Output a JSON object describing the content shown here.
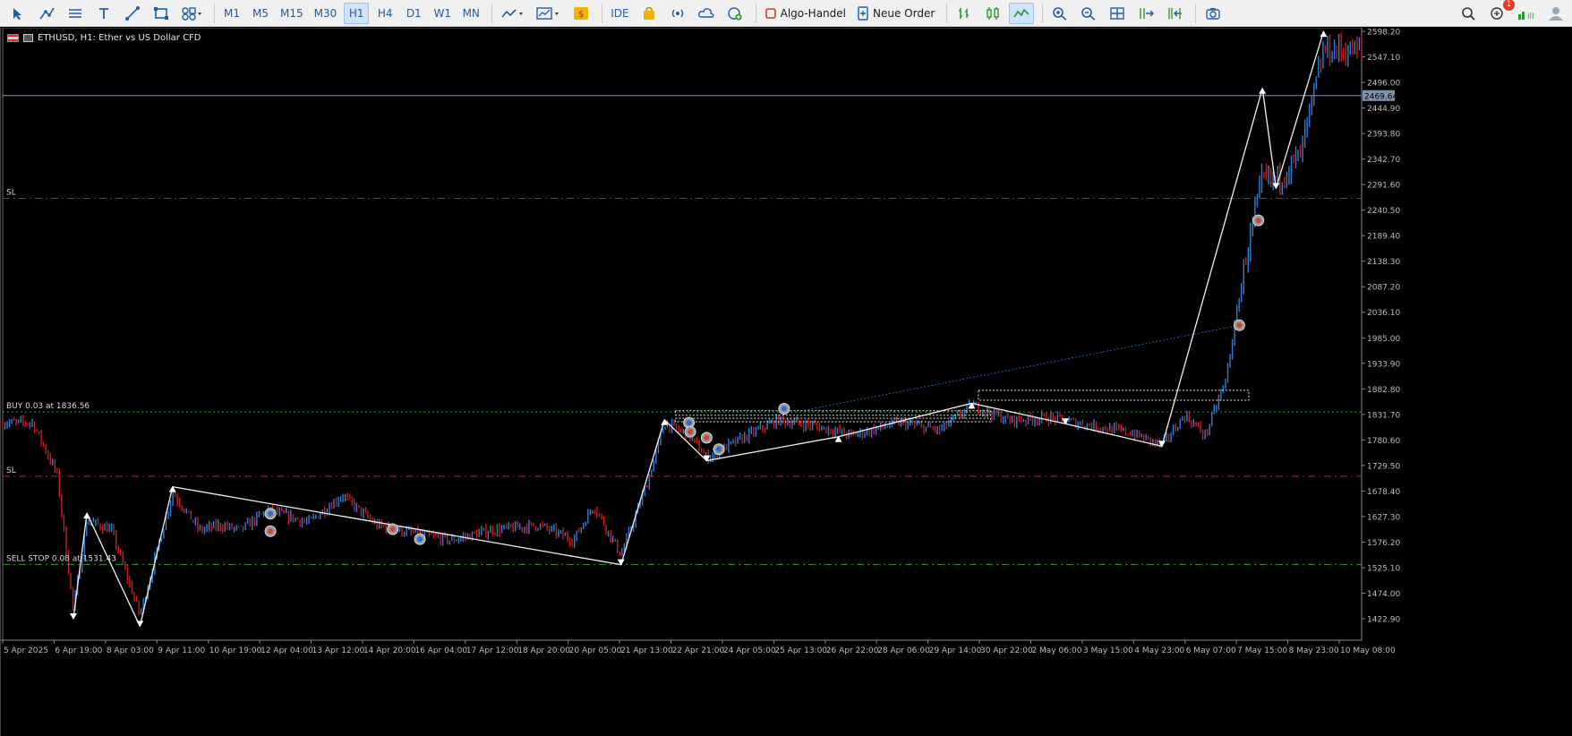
{
  "toolbar": {
    "timeframes": [
      "M1",
      "M5",
      "M15",
      "M30",
      "H1",
      "H4",
      "D1",
      "W1",
      "MN"
    ],
    "active_timeframe": "H1",
    "ide_label": "IDE",
    "algo_label": "Algo-Handel",
    "order_label": "Neue Order",
    "notification_count": "1"
  },
  "chart": {
    "symbol_line": "ETHUSD, H1:  Ether vs US Dollar CFD",
    "current_price": "2469.64",
    "colors": {
      "up": "#2f7fd8",
      "down": "#c81e1e",
      "background": "#000000",
      "axis_text": "#bdbdbd",
      "sl_line": "#c81e1e",
      "buy_line": "#2e9b2e"
    },
    "price_ticks": [
      "2598.20",
      "2547.10",
      "2496.00",
      "2444.90",
      "2393.80",
      "2342.70",
      "2291.60",
      "2240.50",
      "2189.40",
      "2138.30",
      "2087.20",
      "2036.10",
      "1985.00",
      "1933.90",
      "1882.80",
      "1831.70",
      "1780.60",
      "1729.50",
      "1678.40",
      "1627.30",
      "1576.20",
      "1525.10",
      "1474.00",
      "1422.90"
    ],
    "time_ticks": [
      "5 Apr 2025",
      "6 Apr 19:00",
      "8 Apr 03:00",
      "9 Apr 11:00",
      "10 Apr 19:00",
      "12 Apr 04:00",
      "13 Apr 12:00",
      "14 Apr 20:00",
      "16 Apr 04:00",
      "17 Apr 12:00",
      "18 Apr 20:00",
      "20 Apr 05:00",
      "21 Apr 13:00",
      "22 Apr 21:00",
      "24 Apr 05:00",
      "25 Apr 13:00",
      "26 Apr 22:00",
      "28 Apr 06:00",
      "29 Apr 14:00",
      "30 Apr 22:00",
      "2 May 06:00",
      "3 May 15:00",
      "4 May 23:00",
      "6 May 07:00",
      "7 May 15:00",
      "8 May 23:00",
      "10 May 08:00"
    ],
    "level_labels": {
      "sl_upper": "SL",
      "sl_lower": "SL",
      "buy": "BUY 0.03 at 1836.56",
      "sell_stop": "SELL STOP 0.08 at 1531.43"
    },
    "level_prices": {
      "current": 2469.64,
      "sl_upper": 2264,
      "buy": 1836.56,
      "sl_lower": 1708,
      "sell_stop": 1531.43
    },
    "zigzag": [
      {
        "t": 0.052,
        "p": 1423
      },
      {
        "t": 0.062,
        "p": 1634
      },
      {
        "t": 0.101,
        "p": 1408
      },
      {
        "t": 0.125,
        "p": 1687
      },
      {
        "t": 0.455,
        "p": 1531
      },
      {
        "t": 0.487,
        "p": 1821
      },
      {
        "t": 0.518,
        "p": 1739
      },
      {
        "t": 0.615,
        "p": 1787
      },
      {
        "t": 0.713,
        "p": 1854
      },
      {
        "t": 0.782,
        "p": 1813
      },
      {
        "t": 0.853,
        "p": 1768
      },
      {
        "t": 0.927,
        "p": 2484
      },
      {
        "t": 0.937,
        "p": 2284
      },
      {
        "t": 0.972,
        "p": 2598
      }
    ],
    "candle_anchors": [
      {
        "t": 0.0,
        "p": 1815
      },
      {
        "t": 0.022,
        "p": 1815
      },
      {
        "t": 0.04,
        "p": 1712
      },
      {
        "t": 0.052,
        "p": 1440
      },
      {
        "t": 0.062,
        "p": 1620
      },
      {
        "t": 0.08,
        "p": 1600
      },
      {
        "t": 0.101,
        "p": 1430
      },
      {
        "t": 0.125,
        "p": 1675
      },
      {
        "t": 0.145,
        "p": 1600
      },
      {
        "t": 0.16,
        "p": 1610
      },
      {
        "t": 0.175,
        "p": 1600
      },
      {
        "t": 0.195,
        "p": 1640
      },
      {
        "t": 0.225,
        "p": 1615
      },
      {
        "t": 0.25,
        "p": 1670
      },
      {
        "t": 0.275,
        "p": 1610
      },
      {
        "t": 0.3,
        "p": 1595
      },
      {
        "t": 0.33,
        "p": 1580
      },
      {
        "t": 0.36,
        "p": 1600
      },
      {
        "t": 0.395,
        "p": 1610
      },
      {
        "t": 0.42,
        "p": 1580
      },
      {
        "t": 0.435,
        "p": 1650
      },
      {
        "t": 0.455,
        "p": 1550
      },
      {
        "t": 0.475,
        "p": 1700
      },
      {
        "t": 0.487,
        "p": 1815
      },
      {
        "t": 0.505,
        "p": 1790
      },
      {
        "t": 0.518,
        "p": 1745
      },
      {
        "t": 0.545,
        "p": 1785
      },
      {
        "t": 0.57,
        "p": 1820
      },
      {
        "t": 0.595,
        "p": 1810
      },
      {
        "t": 0.625,
        "p": 1790
      },
      {
        "t": 0.66,
        "p": 1815
      },
      {
        "t": 0.69,
        "p": 1800
      },
      {
        "t": 0.713,
        "p": 1850
      },
      {
        "t": 0.74,
        "p": 1820
      },
      {
        "t": 0.77,
        "p": 1825
      },
      {
        "t": 0.8,
        "p": 1810
      },
      {
        "t": 0.83,
        "p": 1795
      },
      {
        "t": 0.853,
        "p": 1770
      },
      {
        "t": 0.87,
        "p": 1830
      },
      {
        "t": 0.885,
        "p": 1790
      },
      {
        "t": 0.9,
        "p": 1900
      },
      {
        "t": 0.915,
        "p": 2150
      },
      {
        "t": 0.927,
        "p": 2300
      },
      {
        "t": 0.937,
        "p": 2300
      },
      {
        "t": 0.955,
        "p": 2350
      },
      {
        "t": 0.972,
        "p": 2560
      }
    ],
    "rectangles": [
      {
        "t1": 0.495,
        "t2": 0.727,
        "p1": 1817,
        "p2": 1824
      },
      {
        "t1": 0.495,
        "t2": 0.727,
        "p1": 1830,
        "p2": 1839
      },
      {
        "t1": 0.718,
        "t2": 0.917,
        "p1": 1860,
        "p2": 1880
      }
    ],
    "trend_dotted": {
      "t1": 0.59,
      "p1": 1840,
      "t2": 0.91,
      "p2": 2010
    },
    "markers": [
      {
        "t": 0.197,
        "p": 1633,
        "kind": "sell"
      },
      {
        "t": 0.197,
        "p": 1598,
        "kind": "buy"
      },
      {
        "t": 0.287,
        "p": 1602,
        "kind": "buy"
      },
      {
        "t": 0.307,
        "p": 1582,
        "kind": "sell"
      },
      {
        "t": 0.505,
        "p": 1815,
        "kind": "sell"
      },
      {
        "t": 0.506,
        "p": 1797,
        "kind": "buy"
      },
      {
        "t": 0.518,
        "p": 1785,
        "kind": "buy"
      },
      {
        "t": 0.527,
        "p": 1762,
        "kind": "sell"
      },
      {
        "t": 0.575,
        "p": 1843,
        "kind": "sell"
      },
      {
        "t": 0.91,
        "p": 2010,
        "kind": "buy"
      },
      {
        "t": 0.924,
        "p": 2220,
        "kind": "buy"
      }
    ]
  }
}
